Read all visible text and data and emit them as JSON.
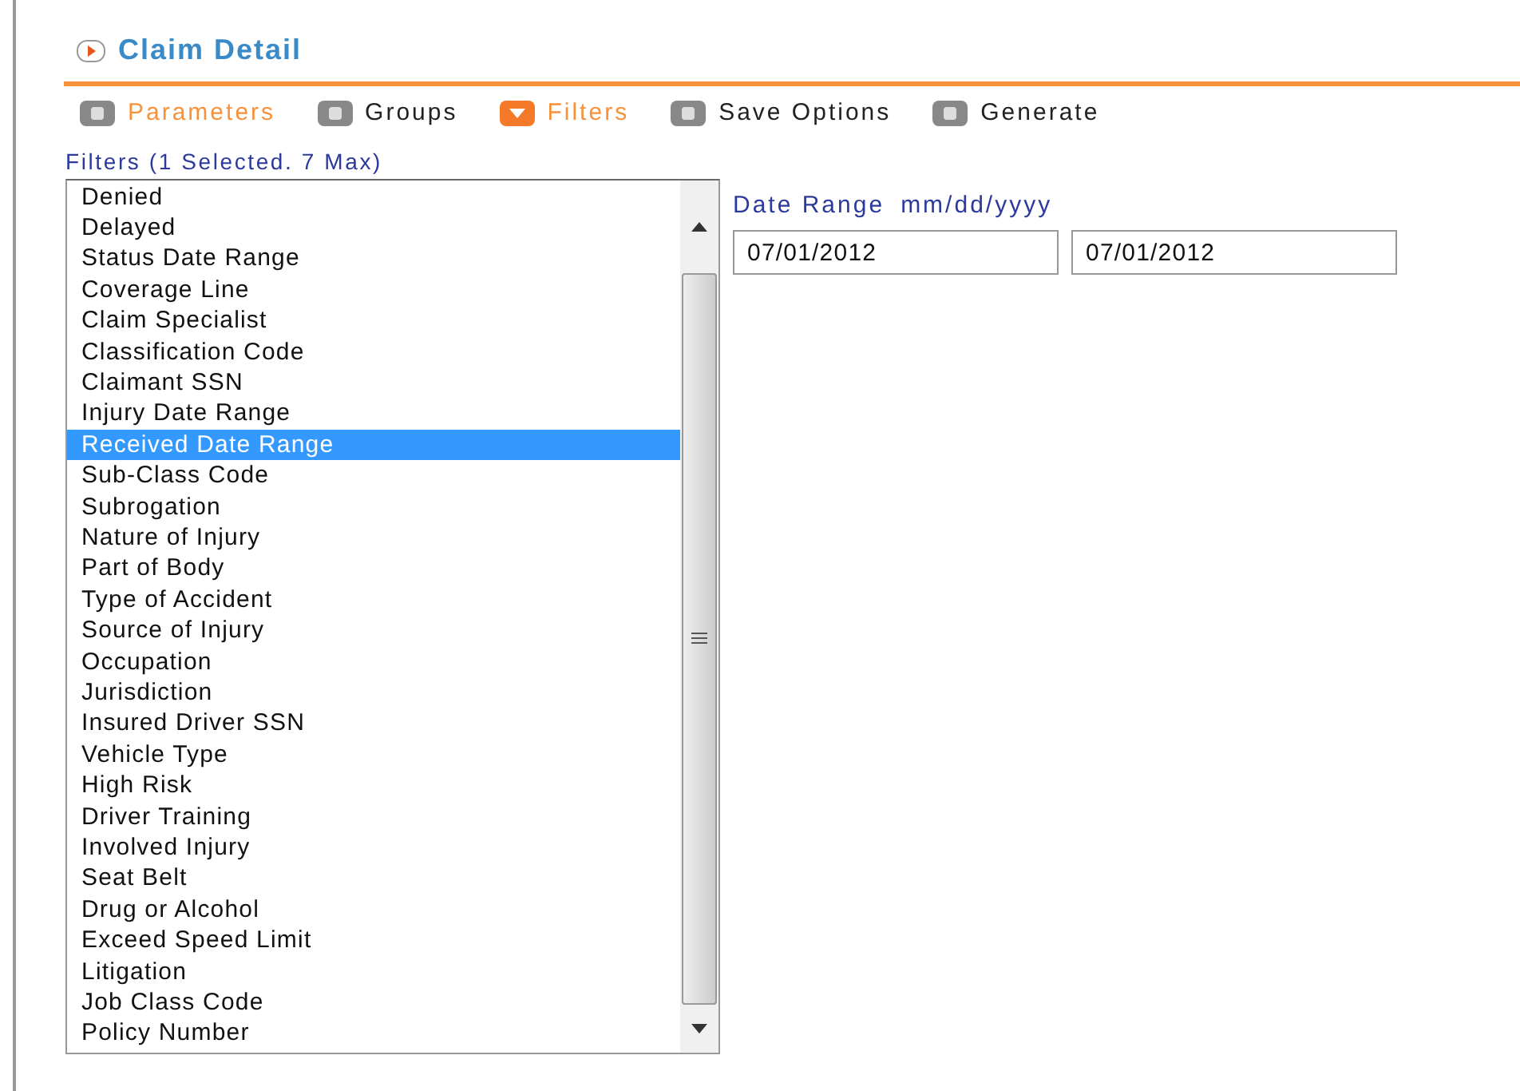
{
  "title": "Claim Detail",
  "steps": [
    {
      "label": "Parameters",
      "selected": false,
      "visited": true
    },
    {
      "label": "Groups",
      "selected": false,
      "visited": false
    },
    {
      "label": "Filters",
      "selected": true,
      "visited": true
    },
    {
      "label": "Save Options",
      "selected": false,
      "visited": false
    },
    {
      "label": "Generate",
      "selected": false,
      "visited": false
    }
  ],
  "filters_label": "Filters (1 Selected. 7 Max)",
  "filters": [
    {
      "label": "Denied",
      "selected": false
    },
    {
      "label": "Delayed",
      "selected": false
    },
    {
      "label": "Status Date Range",
      "selected": false
    },
    {
      "label": "Coverage Line",
      "selected": false
    },
    {
      "label": "Claim Specialist",
      "selected": false
    },
    {
      "label": "Classification Code",
      "selected": false
    },
    {
      "label": "Claimant SSN",
      "selected": false
    },
    {
      "label": "Injury Date Range",
      "selected": false
    },
    {
      "label": "Received Date Range",
      "selected": true
    },
    {
      "label": "Sub-Class Code",
      "selected": false
    },
    {
      "label": "Subrogation",
      "selected": false
    },
    {
      "label": "Nature of Injury",
      "selected": false
    },
    {
      "label": "Part of Body",
      "selected": false
    },
    {
      "label": "Type of Accident",
      "selected": false
    },
    {
      "label": "Source of Injury",
      "selected": false
    },
    {
      "label": "Occupation",
      "selected": false
    },
    {
      "label": "Jurisdiction",
      "selected": false
    },
    {
      "label": "Insured Driver SSN",
      "selected": false
    },
    {
      "label": "Vehicle Type",
      "selected": false
    },
    {
      "label": "High Risk",
      "selected": false
    },
    {
      "label": "Driver Training",
      "selected": false
    },
    {
      "label": "Involved Injury",
      "selected": false
    },
    {
      "label": "Seat Belt",
      "selected": false
    },
    {
      "label": "Drug or Alcohol",
      "selected": false
    },
    {
      "label": "Exceed Speed Limit",
      "selected": false
    },
    {
      "label": "Litigation",
      "selected": false
    },
    {
      "label": "Job Class Code",
      "selected": false
    },
    {
      "label": "Policy Number",
      "selected": false
    }
  ],
  "date_range": {
    "label": "Date Range",
    "format": "mm/dd/yyyy",
    "from": "07/01/2012",
    "to": "07/01/2012"
  }
}
